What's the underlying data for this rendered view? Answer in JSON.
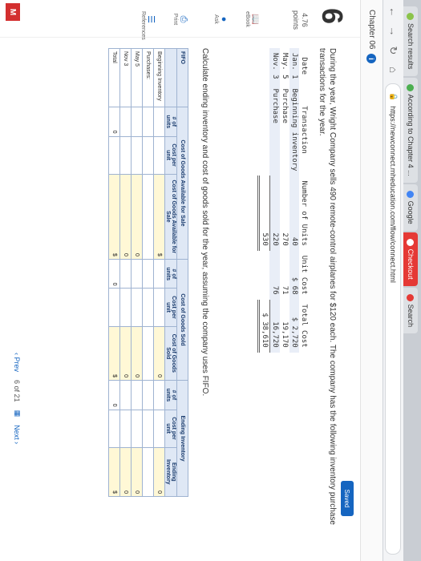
{
  "browser": {
    "tabs": [
      {
        "label": "Search results",
        "active": false
      },
      {
        "label": "According to Chapter 4 ...",
        "active": false
      },
      {
        "label": "Google",
        "active": false
      },
      {
        "label": "Checkout",
        "active": true
      },
      {
        "label": "Search",
        "active": false
      }
    ],
    "url": "https://newconnect.mheducation.com/flow/connect.html"
  },
  "app": {
    "chapter": "Chapter 06",
    "info_icon": "i",
    "question_number": "6",
    "points": "4.76",
    "points_label": "points",
    "saved_label": "Saved",
    "side_links": [
      "eBook",
      "Ask",
      "Print",
      "References"
    ]
  },
  "problem": {
    "text": "During the year, Wright Company sells 490 remote-control airplanes for $120 each. The company has the following inventory purchase transactions for the year."
  },
  "inventory": {
    "headers": [
      "Date",
      "Transaction",
      "Number of Units",
      "Unit Cost",
      "Total Cost"
    ],
    "rows": [
      {
        "date": "Jan. 1",
        "transaction": "Beginning inventory",
        "units": "40",
        "unit_cost": "$ 68",
        "total": "$ 2,720"
      },
      {
        "date": "May. 5",
        "transaction": "Purchase",
        "units": "270",
        "unit_cost": "71",
        "total": "19,170"
      },
      {
        "date": "Nov. 3",
        "transaction": "Purchase",
        "units": "220",
        "unit_cost": "76",
        "total": "16,720"
      }
    ],
    "total_units": "530",
    "total_cost": "$ 38,610"
  },
  "instructions": "Calculate ending inventory and cost of goods sold for the year, assuming the company uses FIFO.",
  "fifo": {
    "title": "FIFO",
    "group_available": "Cost of Goods Available for Sale",
    "group_sold": "Cost of Goods Sold",
    "group_ending": "Ending Inventory",
    "col_units": "# of units",
    "col_cost_per_unit": "Cost per unit",
    "col_cogas": "Cost of Goods Available for Sale",
    "col_cogs": "Cost of Goods Sold",
    "col_ending": "Ending Inventory",
    "rows": [
      {
        "label": "Beginning Inventory"
      },
      {
        "label": "Purchases:"
      },
      {
        "label": "May 5"
      },
      {
        "label": "Nov 3"
      },
      {
        "label": "Total"
      }
    ],
    "dollar": "$",
    "zero": "0"
  },
  "pager": {
    "prev": "Prev",
    "page": "6",
    "of": "of 21",
    "next": "Next"
  }
}
